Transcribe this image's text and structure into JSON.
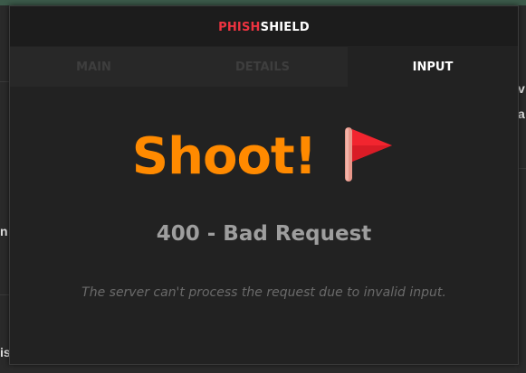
{
  "app": {
    "brand_part1": "PHISH",
    "brand_part2": "SHIELD",
    "brand_accent_color": "#ee3340"
  },
  "tabs": [
    {
      "label": "MAIN",
      "active": false
    },
    {
      "label": "DETAILS",
      "active": false
    },
    {
      "label": "INPUT",
      "active": true
    }
  ],
  "error": {
    "headline": "Shoot!",
    "headline_color": "#ff8a00",
    "icon": "red-flag-icon",
    "status": "400 - Bad Request",
    "message": "The server can't process the request due to invalid input."
  },
  "background_fragments": {
    "right_top": "v",
    "right_mid": "a",
    "left_mid": "n",
    "left_bottom": "is"
  }
}
